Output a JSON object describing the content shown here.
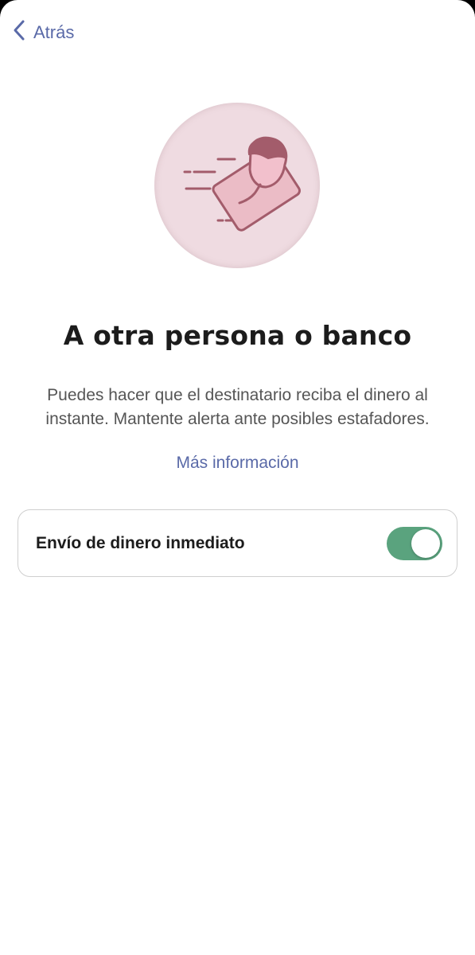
{
  "nav": {
    "back_label": "Atrás",
    "back_icon": "chevron-left-icon",
    "accent": "#5a6aa8"
  },
  "hero": {
    "icon": "send-money-to-person-icon",
    "circle_color": "#efdbe1",
    "icon_color": "#a35c6b"
  },
  "main": {
    "title": "A otra persona o banco",
    "description": "Puedes hacer que el destinatario reciba el dinero al instante. Mantente alerta ante posibles estafadores.",
    "more_link": "Más información"
  },
  "setting": {
    "label": "Envío de dinero inmediato",
    "enabled": true,
    "switch_color": "#5aa37e"
  }
}
